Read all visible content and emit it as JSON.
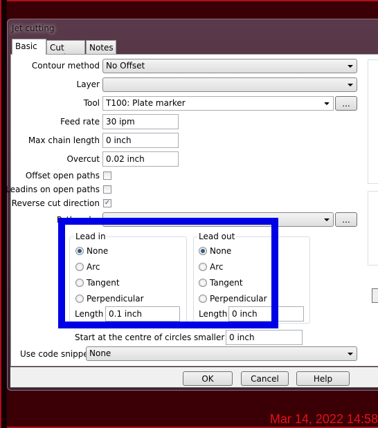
{
  "window": {
    "title": "Jet cutting"
  },
  "tabs": [
    {
      "label": "Basic"
    },
    {
      "label": "Cut path"
    },
    {
      "label": "Notes"
    }
  ],
  "fields": {
    "contour_method": {
      "label": "Contour method",
      "value": "No Offset"
    },
    "layer": {
      "label": "Layer",
      "value": ""
    },
    "tool": {
      "label": "Tool",
      "value": "T100: Plate marker",
      "button": "..."
    },
    "feed_rate": {
      "label": "Feed rate",
      "value": "30 ipm"
    },
    "max_chain_length": {
      "label": "Max chain length",
      "value": "0 inch"
    },
    "overcut": {
      "label": "Overcut",
      "value": "0.02 inch"
    },
    "offset_open_paths": {
      "label": "Offset open paths",
      "checked": false
    },
    "leadins_open_paths": {
      "label": "Leadins on open paths",
      "checked": false
    },
    "reverse_cut": {
      "label": "Reverse cut direction",
      "checked": true,
      "mark": "✓"
    },
    "path_order": {
      "label": "Path order",
      "button": "..."
    },
    "start_centre": {
      "label": "Start at the centre of circles smaller than",
      "value": "0 inch"
    },
    "code_snippet": {
      "label": "Use code snippet",
      "value": "None"
    }
  },
  "lead_in": {
    "title": "Lead in",
    "options": [
      "None",
      "Arc",
      "Tangent",
      "Perpendicular"
    ],
    "selected": "None",
    "length_label": "Length",
    "length": "0.1 inch"
  },
  "lead_out": {
    "title": "Lead out",
    "options": [
      "None",
      "Arc",
      "Tangent",
      "Perpendicular"
    ],
    "selected": "None",
    "length_label": "Length",
    "length": "0 inch"
  },
  "buttons": {
    "ok": "OK",
    "cancel": "Cancel",
    "help": "Help"
  },
  "highlight_color": "#0000e6",
  "timestamp": "Mar 14, 2022 14:58"
}
